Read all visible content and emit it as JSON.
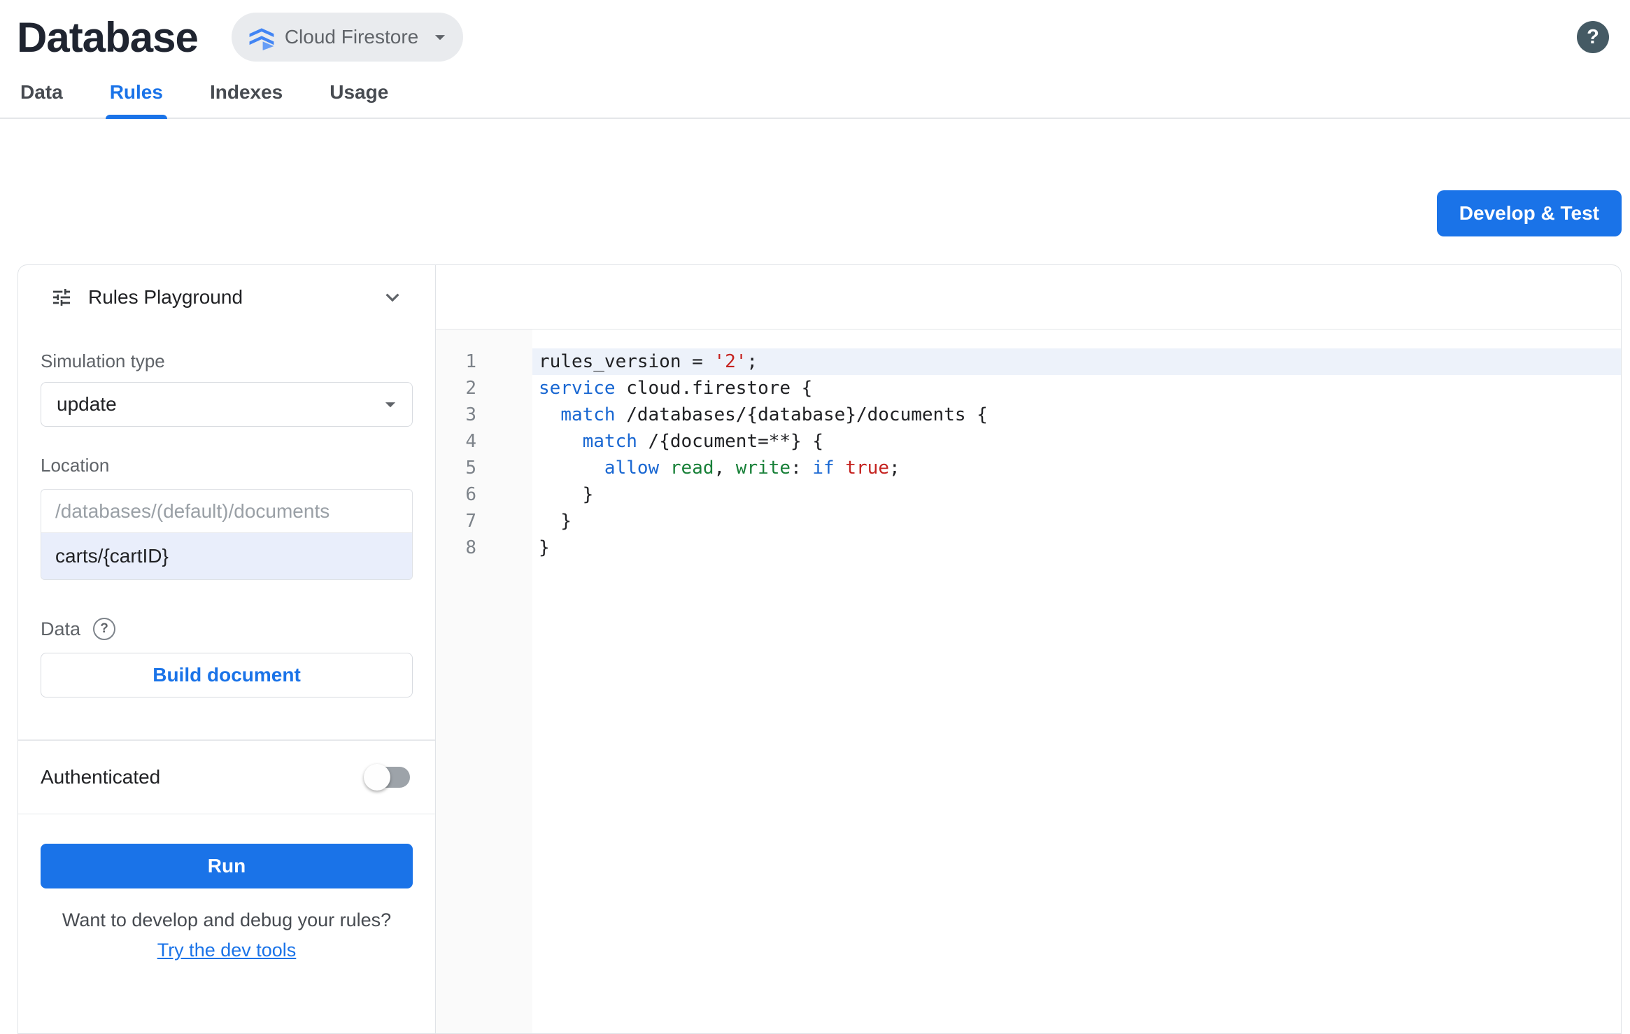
{
  "colors": {
    "accent": "#1a73e8",
    "title_text": "#1f2430",
    "tab_inactive": "#474b51",
    "label_gray": "#5f6368",
    "border_gray": "#e0e3e7",
    "code_keyword": "#1967d2",
    "code_string": "#c5221f",
    "code_permission": "#188038",
    "code_plain": "#202124",
    "active_line_bg": "#edf2fa",
    "editor_gutter_bg": "#fafafa",
    "toggle_off_track": "#9da3a9"
  },
  "header": {
    "title": "Database",
    "product_selector": {
      "label": "Cloud Firestore",
      "icon": "firestore-icon"
    },
    "help": {
      "icon": "help-icon",
      "glyph": "?"
    }
  },
  "tabs": [
    {
      "label": "Data",
      "active": false
    },
    {
      "label": "Rules",
      "active": true
    },
    {
      "label": "Indexes",
      "active": false
    },
    {
      "label": "Usage",
      "active": false
    }
  ],
  "toolbar": {
    "develop_test_label": "Develop & Test"
  },
  "playground": {
    "title": "Rules Playground",
    "tune_icon": "tune-icon",
    "collapse_icon": "chevron-down-icon",
    "simulation_type": {
      "label": "Simulation type",
      "value": "update"
    },
    "location": {
      "label": "Location",
      "prefix_placeholder": "/databases/(default)/documents",
      "path_value": "carts/{cartID}"
    },
    "data_section": {
      "label": "Data",
      "help_glyph": "?",
      "build_button_label": "Build document"
    },
    "authenticated": {
      "label": "Authenticated",
      "enabled": false
    },
    "run_button_label": "Run",
    "footer": {
      "question": "Want to develop and debug your rules?",
      "link_label": "Try the dev tools"
    }
  },
  "editor": {
    "active_line": 1,
    "lines": [
      {
        "num": 1,
        "tokens": [
          [
            "plain",
            "rules_version = "
          ],
          [
            "str",
            "'2'"
          ],
          [
            "plain",
            ";"
          ]
        ]
      },
      {
        "num": 2,
        "tokens": [
          [
            "kw",
            "service"
          ],
          [
            "plain",
            " cloud.firestore {"
          ]
        ]
      },
      {
        "num": 3,
        "tokens": [
          [
            "plain",
            "  "
          ],
          [
            "kw",
            "match"
          ],
          [
            "plain",
            " /databases/{database}/documents {"
          ]
        ]
      },
      {
        "num": 4,
        "tokens": [
          [
            "plain",
            "    "
          ],
          [
            "kw",
            "match"
          ],
          [
            "plain",
            " /{document=**} {"
          ]
        ]
      },
      {
        "num": 5,
        "tokens": [
          [
            "plain",
            "      "
          ],
          [
            "kw",
            "allow"
          ],
          [
            "plain",
            " "
          ],
          [
            "perm",
            "read"
          ],
          [
            "plain",
            ", "
          ],
          [
            "perm",
            "write"
          ],
          [
            "plain",
            ": "
          ],
          [
            "kw",
            "if"
          ],
          [
            "plain",
            " "
          ],
          [
            "str",
            "true"
          ],
          [
            "plain",
            ";"
          ]
        ]
      },
      {
        "num": 6,
        "tokens": [
          [
            "plain",
            "    }"
          ]
        ]
      },
      {
        "num": 7,
        "tokens": [
          [
            "plain",
            "  }"
          ]
        ]
      },
      {
        "num": 8,
        "tokens": [
          [
            "plain",
            "}"
          ]
        ]
      }
    ]
  }
}
